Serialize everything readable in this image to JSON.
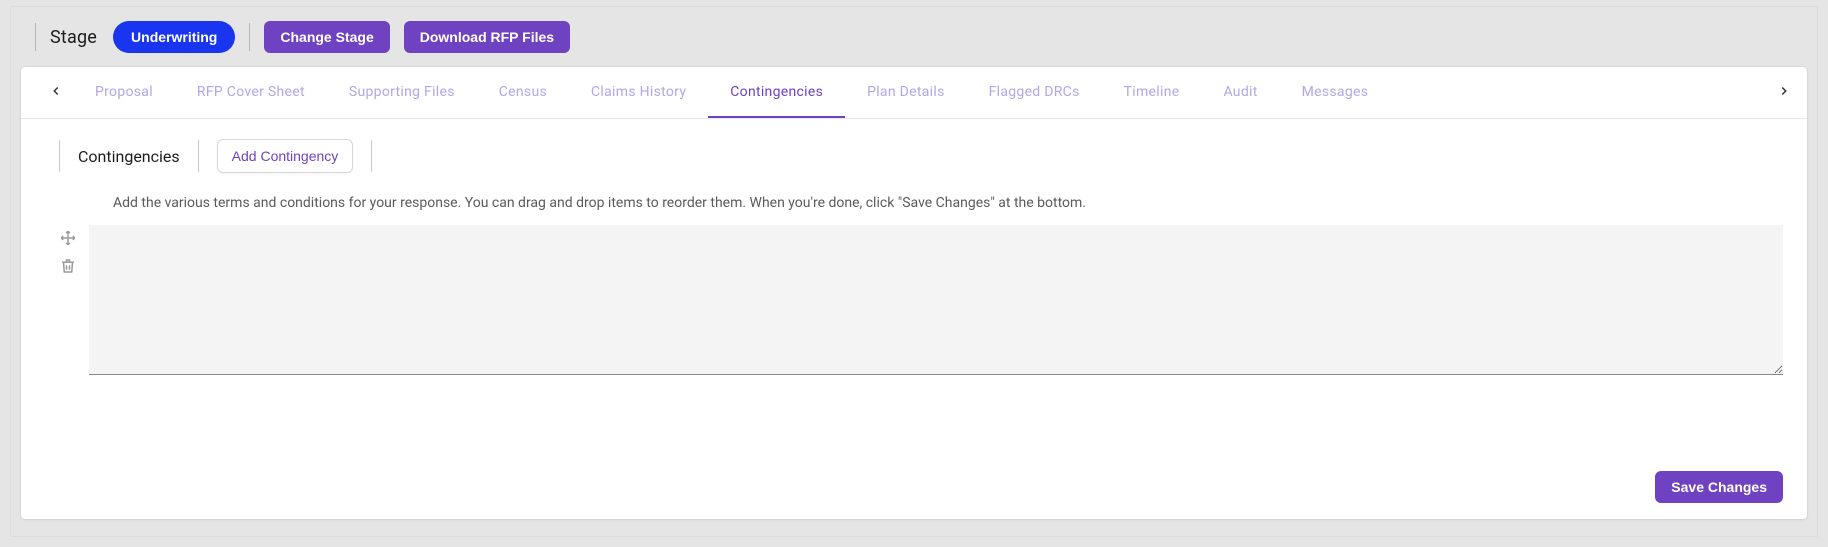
{
  "stage": {
    "label": "Stage",
    "pill": "Underwriting",
    "change_stage_label": "Change Stage",
    "download_label": "Download RFP Files"
  },
  "tabs": [
    {
      "label": "Proposal"
    },
    {
      "label": "RFP Cover Sheet"
    },
    {
      "label": "Supporting Files"
    },
    {
      "label": "Census"
    },
    {
      "label": "Claims History"
    },
    {
      "label": "Contingencies"
    },
    {
      "label": "Plan Details"
    },
    {
      "label": "Flagged DRCs"
    },
    {
      "label": "Timeline"
    },
    {
      "label": "Audit"
    },
    {
      "label": "Messages"
    }
  ],
  "tabs_active_index": 5,
  "section": {
    "title": "Contingencies",
    "add_button": "Add Contingency",
    "help_text": "Add the various terms and conditions for your response. You can drag and drop items to reorder them. When you're done, click \"Save Changes\" at the bottom."
  },
  "item": {
    "value": ""
  },
  "footer": {
    "save_label": "Save Changes"
  },
  "colors": {
    "accent_blue": "#1a35ef",
    "accent_purple": "#6f42c1",
    "tab_inactive": "#b2a6e8"
  }
}
